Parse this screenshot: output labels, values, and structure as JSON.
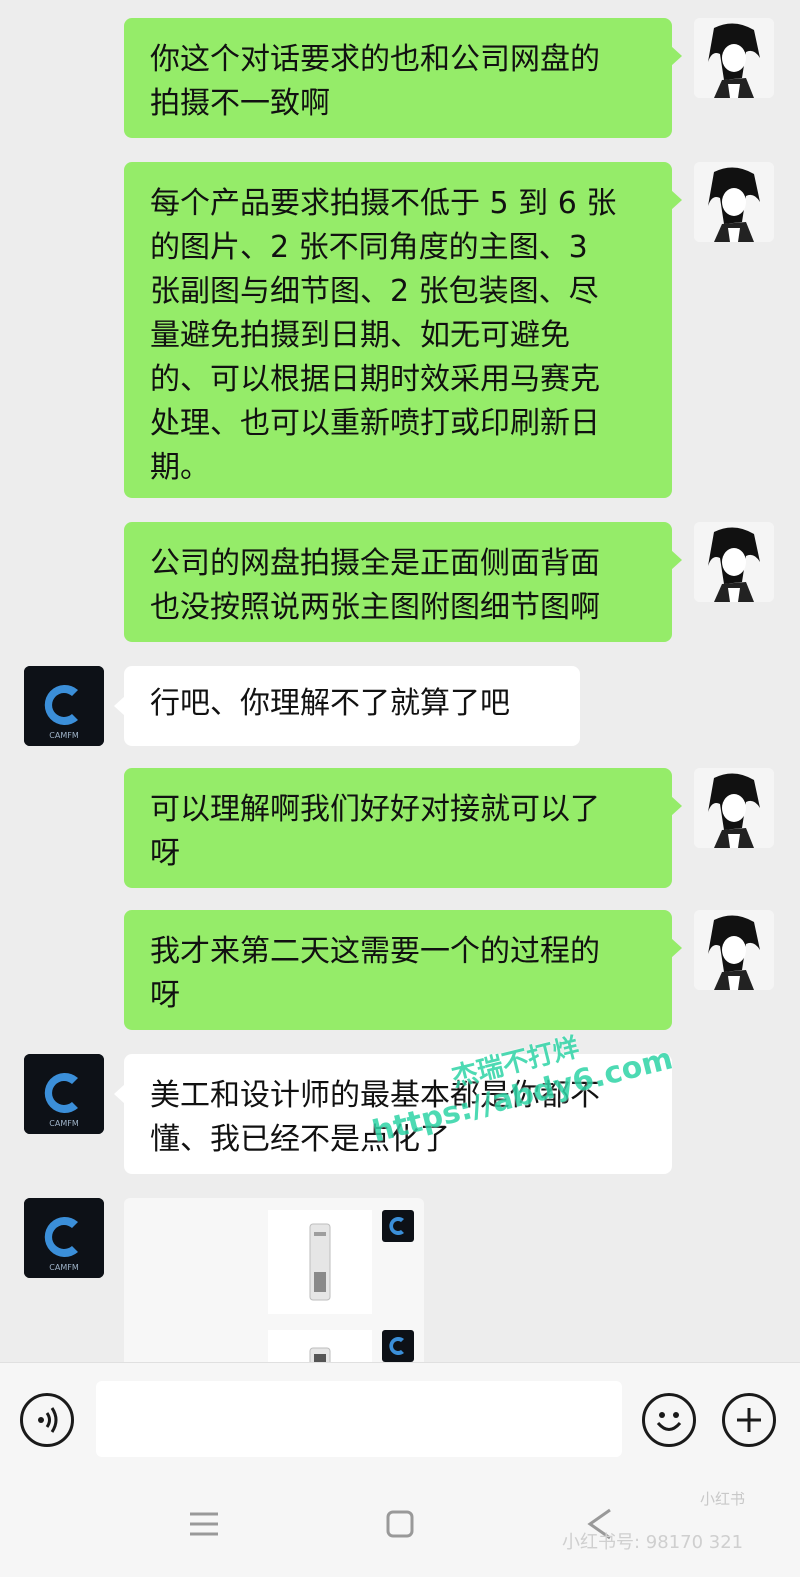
{
  "messages": [
    {
      "sender": "me",
      "text": "你这个对话要求的也和公司网盘的\n拍摄不一致啊"
    },
    {
      "sender": "me",
      "text": "每个产品要求拍摄不低于 5 到 6 张\n的图片、2 张不同角度的主图、3\n张副图与细节图、2 张包装图、尽\n量避免拍摄到日期、如无可避免\n的、可以根据日期时效采用马赛克\n处理、也可以重新喷打或印刷新日\n期。"
    },
    {
      "sender": "me",
      "text": "公司的网盘拍摄全是正面侧面背面\n也没按照说两张主图附图细节图啊"
    },
    {
      "sender": "other",
      "text": "行吧、你理解不了就算了吧"
    },
    {
      "sender": "me",
      "text": "可以理解啊我们好好对接就可以了\n呀"
    },
    {
      "sender": "me",
      "text": "我才来第二天这需要一个的过程的\n呀"
    },
    {
      "sender": "other",
      "text": "美工和设计师的最基本都是你都不\n懂、我已经不是点化了"
    }
  ],
  "other_avatar_text": "CAMFM",
  "watermark": {
    "line1": "杰瑞不打烊",
    "line2": "https://abdy6.com"
  },
  "bottom": {
    "brand": "小红书",
    "user_id": "小红书号: 98170 321"
  },
  "icons": {
    "voice": "voice-icon",
    "emoji": "emoji-icon",
    "add": "plus-icon",
    "menu": "menu-icon",
    "home": "home-icon",
    "back": "back-icon"
  }
}
